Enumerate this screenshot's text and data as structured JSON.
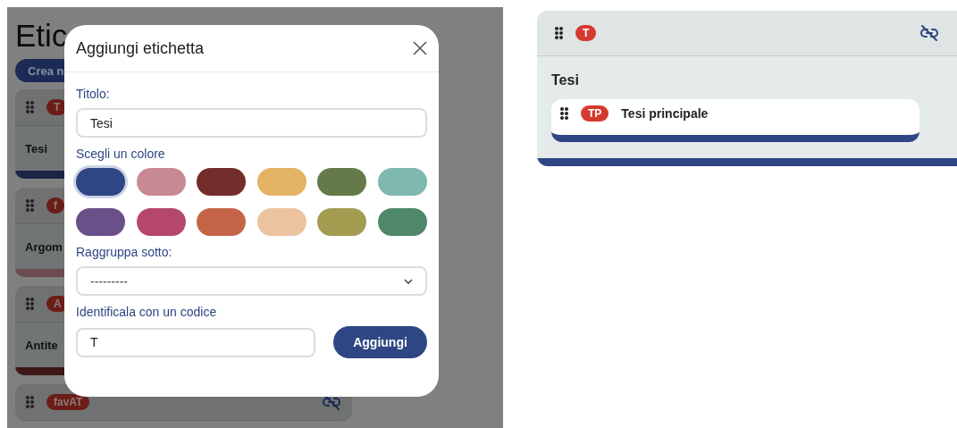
{
  "background_page": {
    "title": "Etic",
    "create_button": "Crea n",
    "cards": [
      {
        "badge": "T",
        "title": "Tesi",
        "color": "#1a2643",
        "unlink_icon": false
      },
      {
        "badge": "f",
        "title": "Argom",
        "color": "#6b4a50",
        "unlink_icon": false
      },
      {
        "badge": "A",
        "title": "Antite",
        "color": "#3d1816",
        "unlink_icon": false
      },
      {
        "badge": "favAT",
        "unlink_icon": true
      }
    ]
  },
  "modal": {
    "title": "Aggiungi etichetta",
    "title_label": "Titolo:",
    "title_value": "Tesi",
    "color_label": "Scegli un colore",
    "colors": [
      {
        "color": "#2e4683",
        "selected": true
      },
      {
        "color": "#c98994",
        "selected": false
      },
      {
        "color": "#732d2a",
        "selected": false
      },
      {
        "color": "#e4b363",
        "selected": false
      },
      {
        "color": "#647a48",
        "selected": false
      },
      {
        "color": "#7fb8ad",
        "selected": false
      },
      {
        "color": "#6a5089",
        "selected": false
      },
      {
        "color": "#b5466e",
        "selected": false
      },
      {
        "color": "#c46548",
        "selected": false
      },
      {
        "color": "#ebc39f",
        "selected": false
      },
      {
        "color": "#a19c50",
        "selected": false
      },
      {
        "color": "#4f876a",
        "selected": false
      }
    ],
    "group_label": "Raggruppa sotto:",
    "group_value": "---------",
    "code_label": "Identificala con un codice",
    "code_value": "T",
    "submit_button": "Aggiungi"
  },
  "preview": {
    "badge": "T",
    "title": "Tesi",
    "color": "#2e4683",
    "unlink_icon": true,
    "children": [
      {
        "badge": "TP",
        "title": "Tesi principale",
        "color": "#2e4683"
      }
    ]
  }
}
